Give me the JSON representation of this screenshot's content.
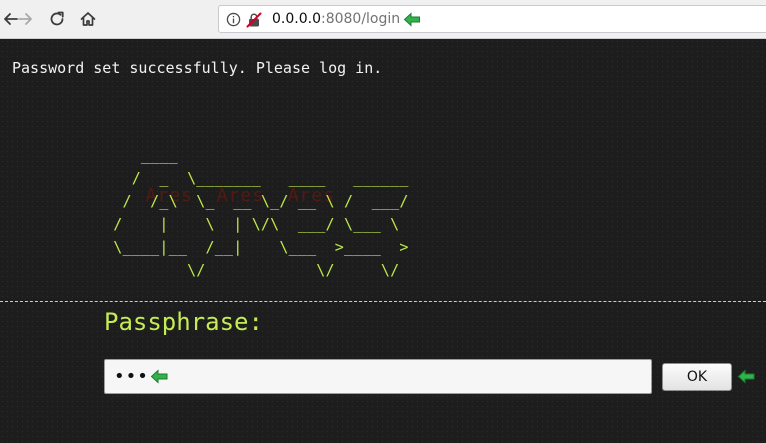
{
  "browser": {
    "url_host": "0.0.0.0",
    "url_rest": ":8080/login",
    "colors": {
      "annotation_arrow": "#2fb34a"
    }
  },
  "page": {
    "status_message": "Password set successfully. Please log in.",
    "ascii_logo": "    ____\n   /  _  \\_______   ____   ______\n  /  /_\\  \\_  __ \\_/ __ \\ /  ___/\n /    |    \\  | \\/\\  ___/ \\___ \\\n \\____|__  /__|    \\___  >____  >\n         \\/            \\/     \\/",
    "ascii_logo_overlay": "  Ares  Ares  Ares",
    "colors": {
      "accent": "#c6ec55",
      "background": "#1d1d1d",
      "divider": "#d6e24a"
    }
  },
  "form": {
    "passphrase_label": "Passphrase:",
    "passphrase_value": "•••",
    "ok_label": "OK"
  }
}
